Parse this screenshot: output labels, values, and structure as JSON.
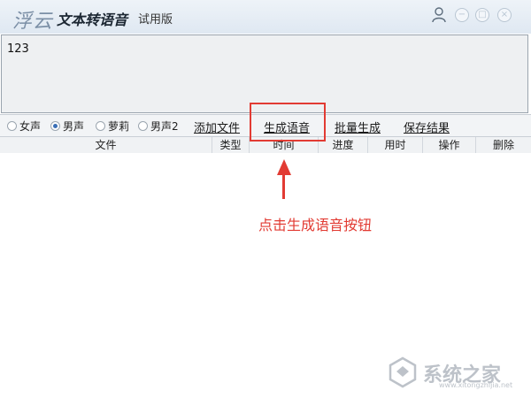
{
  "titlebar": {
    "logo": "浮云",
    "app_name": "文本转语音",
    "edition": "试用版"
  },
  "editor": {
    "text": "123"
  },
  "voices": {
    "options": [
      "女声",
      "男声",
      "萝莉",
      "男声2"
    ],
    "selected": "男声"
  },
  "actions": {
    "add_file": "添加文件",
    "generate": "生成语音",
    "batch": "批量生成",
    "save": "保存结果"
  },
  "table": {
    "columns": [
      "文件",
      "类型",
      "时间",
      "进度",
      "用时",
      "操作",
      "删除"
    ]
  },
  "annotation": {
    "hint": "点击生成语音按钮",
    "color": "#e23b33"
  },
  "watermark": {
    "text": "系统之家",
    "url": "www.xitongzhijia.net"
  }
}
